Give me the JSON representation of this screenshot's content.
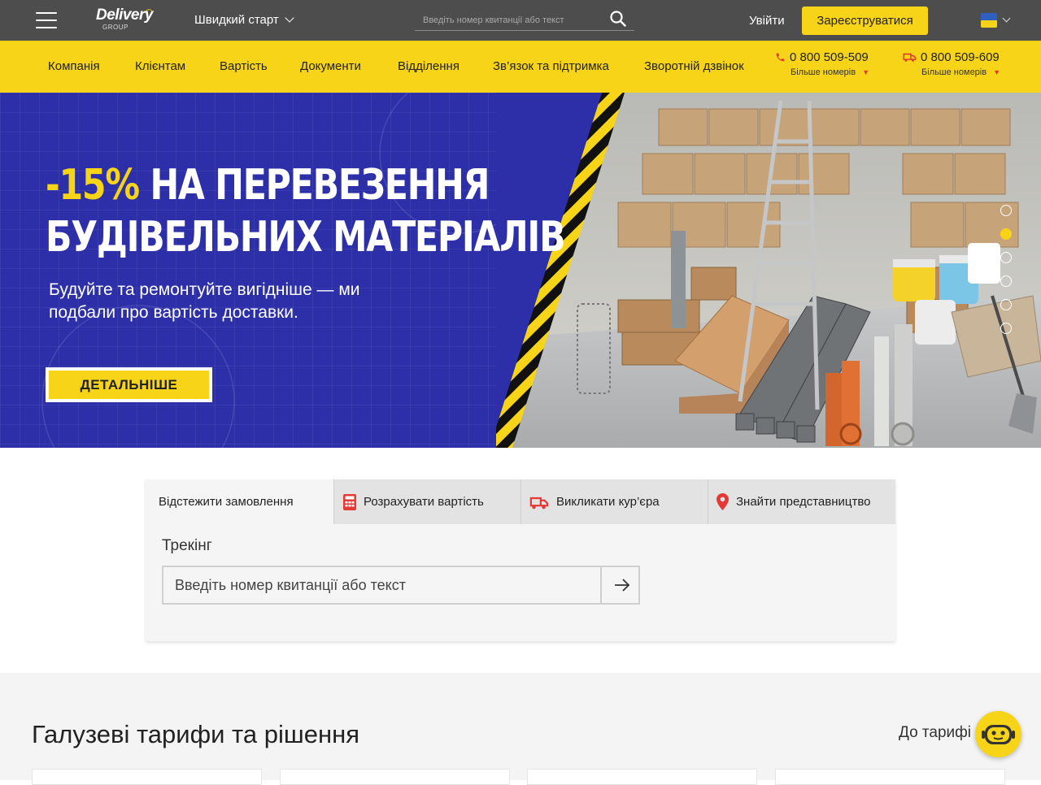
{
  "header": {
    "logo_text": "Delivery",
    "logo_sub": "GROUP",
    "quick_start": "Швидкий старт",
    "search_placeholder": "Введіть номер квитанції або текст",
    "login": "Увійти",
    "register": "Зареєструватися",
    "language_flag": "ua-flag-icon"
  },
  "nav": {
    "items": [
      "Компанія",
      "Клієнтам",
      "Вартість",
      "Документи",
      "Відділення",
      "Зв’язок та підтримка",
      "Зворотній дзвінок"
    ],
    "phones": [
      {
        "number": "0 800 509-509",
        "more": "Більше номерів",
        "icon": "phone-icon"
      },
      {
        "number": "0 800 509-609",
        "more": "Більше номерів",
        "icon": "truck-icon"
      }
    ]
  },
  "hero": {
    "title_accent": "-15%",
    "title_line1_rest": " НА ПЕРЕВЕЗЕННЯ",
    "title_line2": "БУДІВЕЛЬНИХ МАТЕРІАЛІВ",
    "subtitle": "Будуйте та ремонтуйте вигідніше — ми подбали про вартість доставки.",
    "button": "ДЕТАЛЬНІШЕ",
    "slides_count": 6,
    "active_slide": 2
  },
  "widget": {
    "tabs": [
      {
        "label": "Відстежити замовлення",
        "icon": "",
        "active": true
      },
      {
        "label": "Розрахувати вартість",
        "icon": "calculator-icon",
        "active": false
      },
      {
        "label": "Викликати кур’єра",
        "icon": "truck-icon",
        "active": false
      },
      {
        "label": "Знайти представництво",
        "icon": "map-pin-icon",
        "active": false
      }
    ],
    "tracking_label": "Трекінг",
    "input_placeholder": "Введіть номер квитанції або текст"
  },
  "industry": {
    "title": "Галузеві тарифи та рішення",
    "link": "До тарифі"
  },
  "colors": {
    "brand_yellow": "#f7d417",
    "topbar_gray": "#4d4d4d",
    "hero_blue": "#2c2fa8",
    "accent_red": "#e53935"
  }
}
